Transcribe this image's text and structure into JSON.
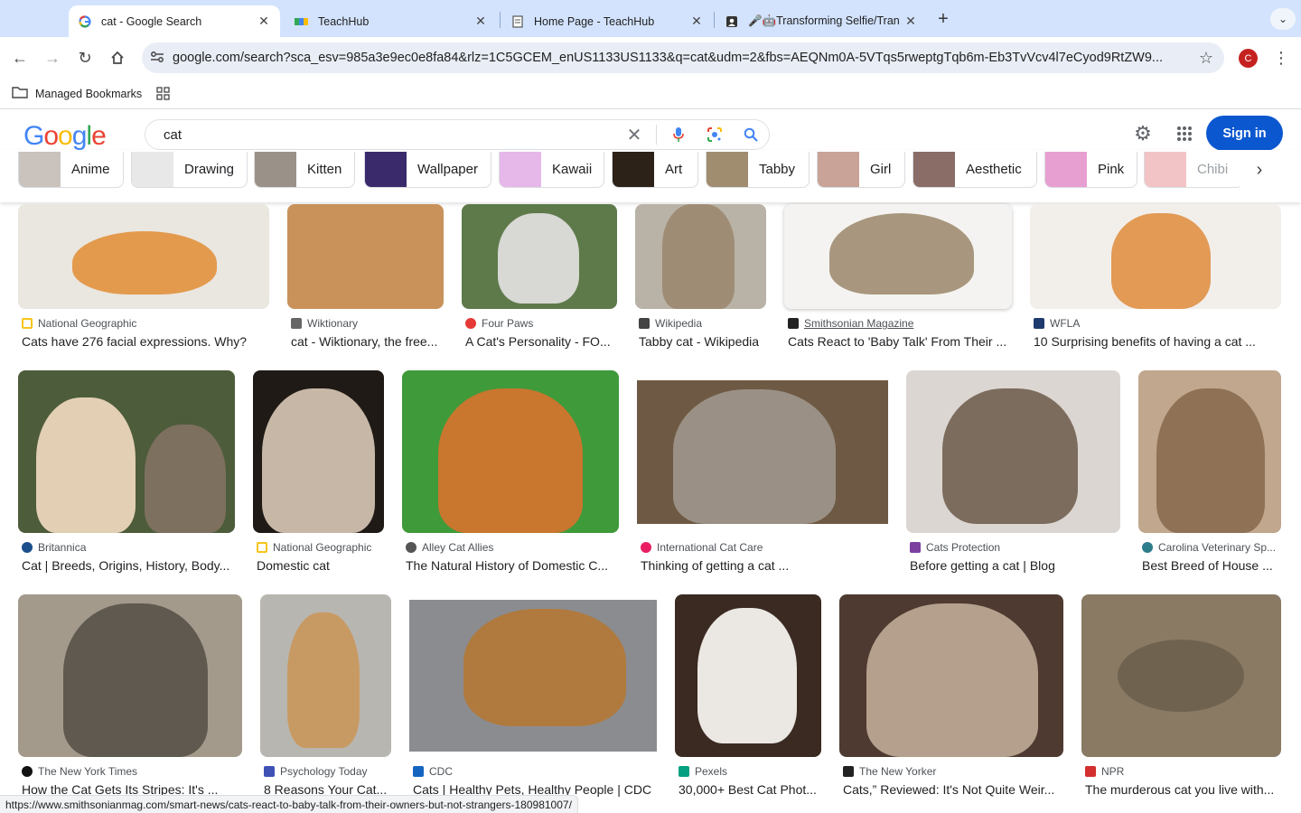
{
  "tabs": [
    {
      "title": "cat - Google Search",
      "active": true,
      "icon": "google-g-icon"
    },
    {
      "title": "TeachHub",
      "active": false,
      "icon": "teachhub-icon"
    },
    {
      "title": "Home Page - TeachHub",
      "active": false,
      "icon": "document-icon"
    },
    {
      "title": "🎤🤖Transforming Selfie/Tran",
      "active": false,
      "icon": "portrait-icon"
    }
  ],
  "toolbar": {
    "url": "google.com/search?sca_esv=985a3e9ec0e8fa84&rlz=1C5GCEM_enUS1133US1133&q=cat&udm=2&fbs=AEQNm0A-5VTqs5rweptgTqb6m-Eb3TvVcv4l7eCyod9RtZW9...",
    "profile_initial": "C"
  },
  "bookmarks": {
    "managed": "Managed Bookmarks"
  },
  "google": {
    "logo": "Google",
    "query": "cat",
    "sign_in": "Sign in"
  },
  "chips": [
    {
      "label": "Anime",
      "color": "#c9c2bd"
    },
    {
      "label": "Drawing",
      "color": "#e8e8e8"
    },
    {
      "label": "Kitten",
      "color": "#9a9188"
    },
    {
      "label": "Wallpaper",
      "color": "#3a2a6b"
    },
    {
      "label": "Kawaii",
      "color": "#e6b7e9"
    },
    {
      "label": "Art",
      "color": "#2d2217"
    },
    {
      "label": "Tabby",
      "color": "#a08c6e"
    },
    {
      "label": "Girl",
      "color": "#c9a397"
    },
    {
      "label": "Aesthetic",
      "color": "#8a6d66"
    },
    {
      "label": "Pink",
      "color": "#e79fd1"
    },
    {
      "label": "Chibi",
      "color": "#f2c4c6"
    }
  ],
  "results": [
    {
      "source": "National Geographic",
      "title": "Cats have 276 facial expressions. Why?",
      "icon_color": "#f5c518",
      "color": "#e39a4c"
    },
    {
      "source": "Wiktionary",
      "title": "cat - Wiktionary, the free...",
      "icon_color": "#666666",
      "color": "#c9925a"
    },
    {
      "source": "Four Paws",
      "title": "A Cat's Personality - FO...",
      "icon_color": "#e53935",
      "color": "#5e7a4a"
    },
    {
      "source": "Wikipedia",
      "title": "Tabby cat - Wikipedia",
      "icon_color": "#444444",
      "color": "#9e8c75"
    },
    {
      "source": "Smithsonian Magazine",
      "title": "Cats React to 'Baby Talk' From Their ...",
      "icon_color": "#222222",
      "color": "#d9d4cc",
      "underline": true
    },
    {
      "source": "WFLA",
      "title": "10 Surprising benefits of having a cat ...",
      "icon_color": "#1e3a6e",
      "color": "#e29a55"
    },
    {
      "source": "Britannica",
      "title": "Cat | Breeds, Origins, History, Body...",
      "icon_color": "#1a4f8c",
      "color": "#4d5c3a"
    },
    {
      "source": "National Geographic",
      "title": "Domestic cat",
      "icon_color": "#f5c518",
      "color": "#b7a491"
    },
    {
      "source": "Alley Cat Allies",
      "title": "The Natural History of Domestic C...",
      "icon_color": "#555555",
      "color": "#3f9a3a"
    },
    {
      "source": "International Cat Care",
      "title": "Thinking of getting a cat ...",
      "icon_color": "#e91e63",
      "color": "#6e5a44"
    },
    {
      "source": "Cats Protection",
      "title": "Before getting a cat | Blog",
      "icon_color": "#7b3fa0",
      "color": "#a89888"
    },
    {
      "source": "Carolina Veterinary Sp...",
      "title": "Best Breed of House ...",
      "icon_color": "#2e7d8c",
      "color": "#8f7256"
    },
    {
      "source": "The New York Times",
      "title": "How the Cat Gets Its Stripes: It's ...",
      "icon_color": "#111111",
      "color": "#7a7466"
    },
    {
      "source": "Psychology Today",
      "title": "8 Reasons Your Cat...",
      "icon_color": "#3f51b5",
      "color": "#c89a63"
    },
    {
      "source": "CDC",
      "title": "Cats | Healthy Pets, Healthy People | CDC",
      "icon_color": "#1565c0",
      "color": "#b07a3e"
    },
    {
      "source": "Pexels",
      "title": "30,000+ Best Cat Phot...",
      "icon_color": "#05a081",
      "color": "#3a2a22"
    },
    {
      "source": "The New Yorker",
      "title": "Cats,” Reviewed: It's Not Quite Weir...",
      "icon_color": "#222222",
      "color": "#8e7766"
    },
    {
      "source": "NPR",
      "title": "The murderous cat you live with...",
      "icon_color": "#d32f2f",
      "color": "#8a7a64"
    }
  ],
  "status_url": "https://www.smithsonianmag.com/smart-news/cats-react-to-baby-talk-from-their-owners-but-not-strangers-180981007/"
}
